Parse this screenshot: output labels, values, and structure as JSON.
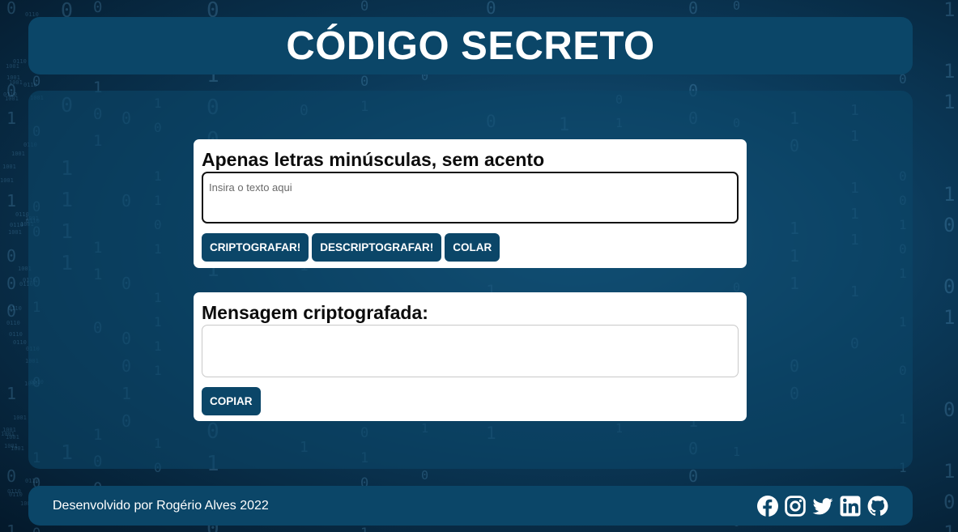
{
  "header": {
    "title": "CÓDIGO SECRETO"
  },
  "encrypt_card": {
    "heading": "Apenas letras minúsculas, sem acento",
    "input_placeholder": "Insira o texto aqui",
    "input_value": "",
    "buttons": {
      "encrypt": "CRIPTOGRAFAR!",
      "decrypt": "DESCRIPTOGRAFAR!",
      "paste": "COLAR"
    }
  },
  "output_card": {
    "heading": "Mensagem criptografada:",
    "output_value": "",
    "copy_button": "COPIAR"
  },
  "footer": {
    "credit": "Desenvolvido por Rogério Alves 2022",
    "socials": [
      {
        "icon": "facebook-icon"
      },
      {
        "icon": "instagram-icon"
      },
      {
        "icon": "twitter-icon"
      },
      {
        "icon": "linkedin-icon"
      },
      {
        "icon": "github-icon"
      }
    ]
  },
  "colors": {
    "primary": "#0b4668",
    "card_bg": "#ffffff",
    "text_dark": "#0c0c0c",
    "text_light": "#ffffff"
  }
}
